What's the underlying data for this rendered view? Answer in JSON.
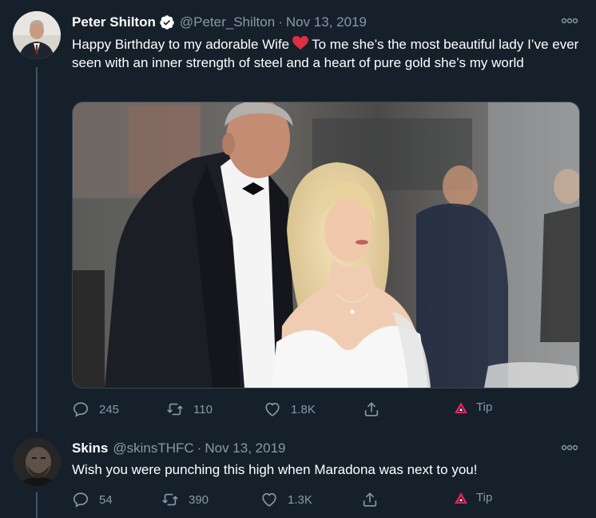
{
  "tweets": [
    {
      "name": "Peter Shilton",
      "handle": "@Peter_Shilton",
      "time": "Nov 13, 2019",
      "text_before": "Happy Birthday to my adorable Wife",
      "text_after": "To me she’s the most beautiful lady I’ve ever seen with an inner strength of steel and a heart of pure gold she’s my world",
      "emoji": "red-heart",
      "replies": "245",
      "retweets": "110",
      "likes": "1.8K",
      "tip": "Tip"
    },
    {
      "name": "Skins",
      "handle": "@skinsTHFC",
      "time": "Nov 13, 2019",
      "text": "Wish you were punching this high when Maradona was next to you!",
      "replies": "54",
      "retweets": "390",
      "likes": "1.3K",
      "tip": "Tip"
    }
  ],
  "separator": "·",
  "colors": {
    "background": "#15202b",
    "secondary_text": "#8899a6",
    "verified": "#ffffff",
    "tip_accent": "#e0245e",
    "heart_emoji": "#dd2e44"
  },
  "icons": [
    "verified-badge-icon",
    "more-options-icon",
    "reply-icon",
    "retweet-icon",
    "like-icon",
    "share-icon",
    "tip-icon"
  ]
}
